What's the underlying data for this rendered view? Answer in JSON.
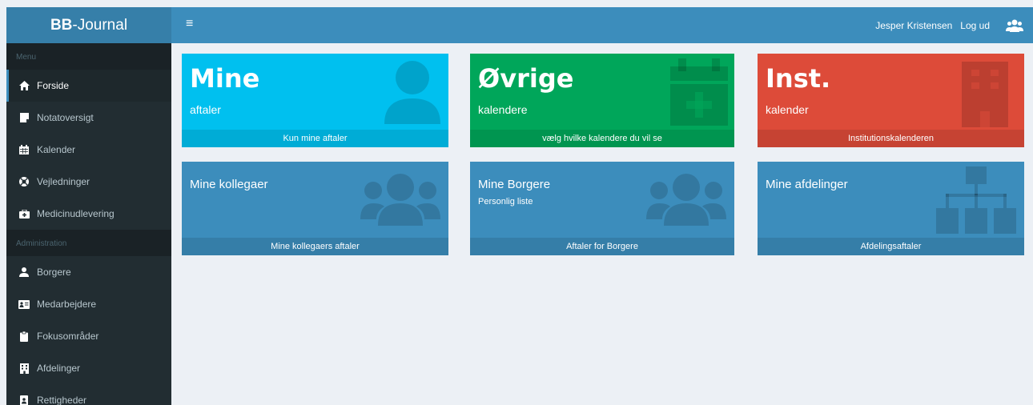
{
  "logo": {
    "bold": "BB",
    "rest": "-Journal"
  },
  "topbar": {
    "toggle_glyph": "≡",
    "user_name": "Jesper Kristensen",
    "logout_label": "Log ud"
  },
  "sidebar": {
    "menu_header": "Menu",
    "menu_items": [
      {
        "label": "Forside",
        "icon": "home-icon"
      },
      {
        "label": "Notatoversigt",
        "icon": "note-icon"
      },
      {
        "label": "Kalender",
        "icon": "calendar-icon"
      },
      {
        "label": "Vejledninger",
        "icon": "lifebuoy-icon"
      },
      {
        "label": "Medicinudlevering",
        "icon": "medkit-icon"
      }
    ],
    "admin_header": "Administration",
    "admin_items": [
      {
        "label": "Borgere",
        "icon": "user-icon"
      },
      {
        "label": "Medarbejdere",
        "icon": "id-card-icon"
      },
      {
        "label": "Fokusområder",
        "icon": "clipboard-icon"
      },
      {
        "label": "Afdelinger",
        "icon": "building-icon"
      },
      {
        "label": "Rettigheder",
        "icon": "id-badge-icon"
      }
    ]
  },
  "boxes": {
    "mine_aftaler": {
      "title": "Mine",
      "subtitle": "aftaler",
      "footer": "Kun mine aftaler",
      "color": "#00c0ef"
    },
    "ovrige": {
      "title": "Øvrige",
      "subtitle": "kalendere",
      "footer": "vælg hvilke kalendere du vil se",
      "color": "#00a65a"
    },
    "inst": {
      "title": "Inst.",
      "subtitle": "kalender",
      "footer": "Institutionskalenderen",
      "color": "#dd4b39"
    },
    "kollegaer": {
      "title": "Mine kollegaer",
      "footer": "Mine kollegaers aftaler",
      "color": "#3c8dbc"
    },
    "borgere": {
      "title": "Mine Borgere",
      "subtitle": "Personlig liste",
      "footer": "Aftaler for Borgere",
      "color": "#3c8dbc"
    },
    "afdelinger": {
      "title": "Mine afdelinger",
      "footer": "Afdelingsaftaler",
      "color": "#3c8dbc"
    }
  }
}
